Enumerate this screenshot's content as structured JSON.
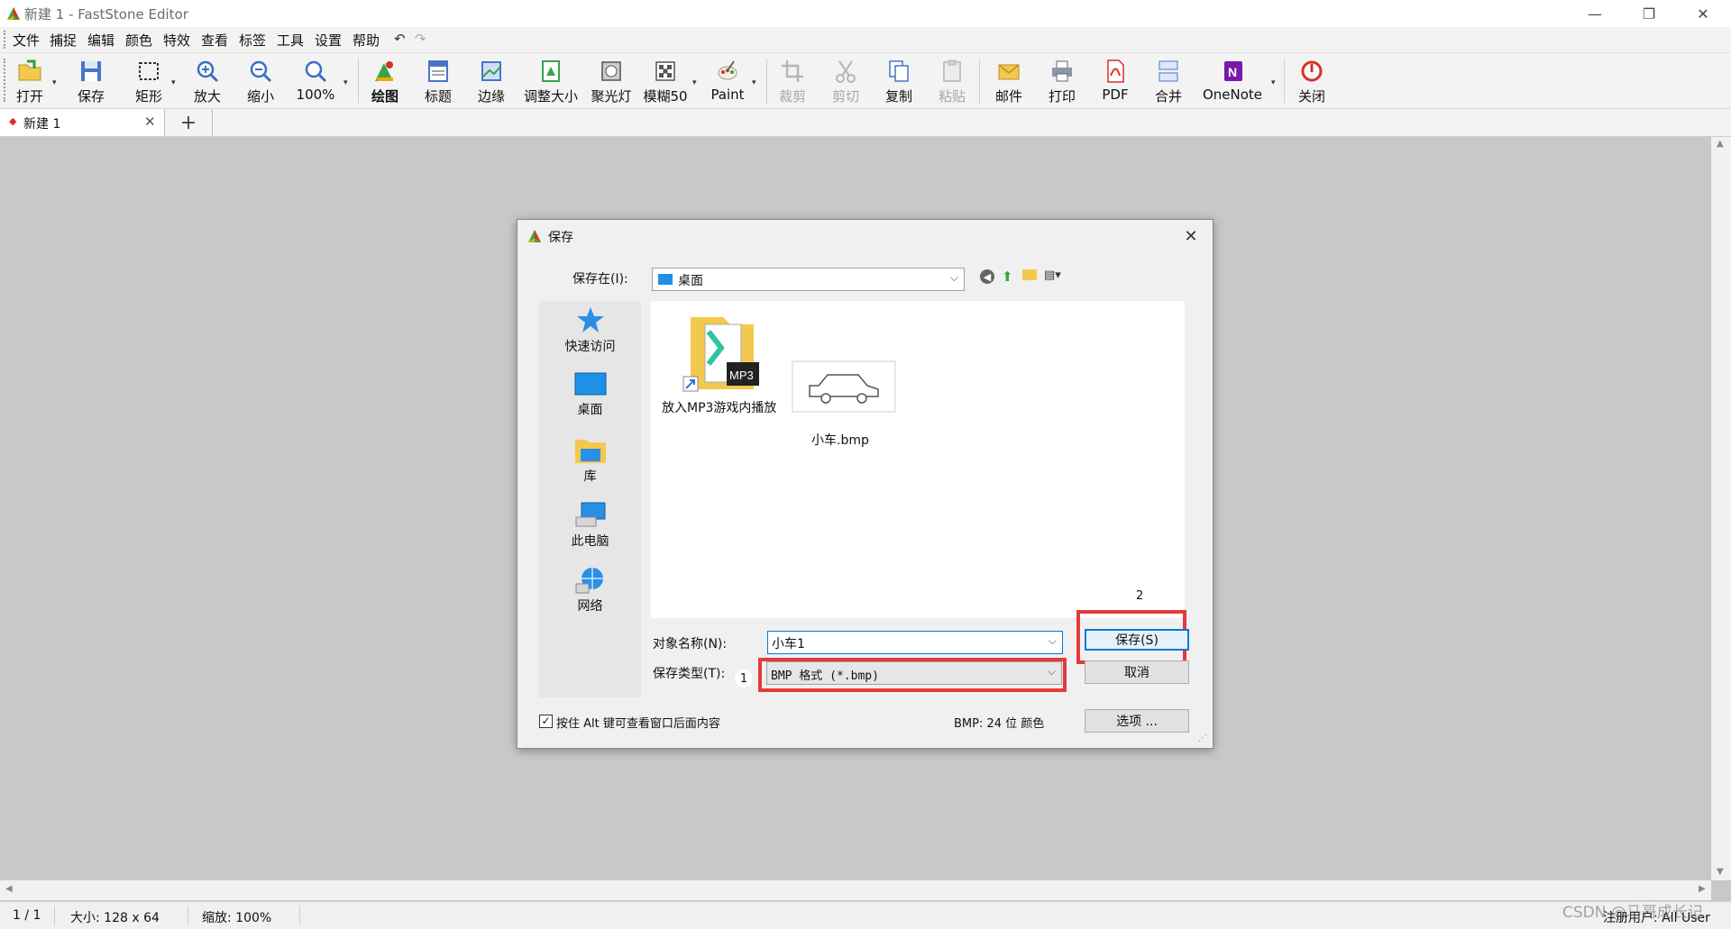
{
  "window": {
    "title": "新建 1 - FastStone Editor",
    "controls": {
      "minimize": "—",
      "restore": "❐",
      "close": "✕"
    }
  },
  "menu": [
    "文件",
    "捕捉",
    "编辑",
    "颜色",
    "特效",
    "查看",
    "标签",
    "工具",
    "设置",
    "帮助"
  ],
  "toolbar": {
    "open": "打开",
    "save": "保存",
    "rect": "矩形",
    "zoom_in": "放大",
    "zoom_out": "缩小",
    "zoom_level": "100%",
    "draw": "绘图",
    "caption": "标题",
    "edge": "边缘",
    "resize": "调整大小",
    "spotlight": "聚光灯",
    "blur": "模糊50",
    "paint": "Paint",
    "crop": "裁剪",
    "cut": "剪切",
    "copy": "复制",
    "paste": "粘贴",
    "email": "邮件",
    "print": "打印",
    "pdf": "PDF",
    "merge": "合并",
    "onenote": "OneNote",
    "close": "关闭"
  },
  "tabs": {
    "active_tab": "新建 1",
    "add_label": "+"
  },
  "status": {
    "page": "1 / 1",
    "size": "大小:  128 x 64",
    "zoom": "缩放:  100%",
    "user": "注册用户: All User",
    "watermark": "CSDN @马哥成长记"
  },
  "dialog": {
    "title": "保存",
    "save_in_label": "保存在(I):",
    "save_in_value": "桌面",
    "places": [
      "快速访问",
      "桌面",
      "库",
      "此电脑",
      "网络"
    ],
    "files": [
      "放入MP3游戏内播放",
      "小车.bmp"
    ],
    "filename_label": "对象名称(N):",
    "filename_value": "小车1",
    "filetype_label": "保存类型(T):",
    "filetype_value": "BMP 格式 (*.bmp)",
    "save_button": "保存(S)",
    "cancel_button": "取消",
    "options_button": "选项 ...",
    "alt_checkbox": "按住 Alt 键可查看窗口后面内容",
    "bmp_info": "BMP: 24 位 颜色",
    "annotation_1": "1",
    "annotation_2": "2"
  },
  "colors": {
    "highlight_red": "#e53a3a",
    "selection_blue": "#0078d7"
  }
}
